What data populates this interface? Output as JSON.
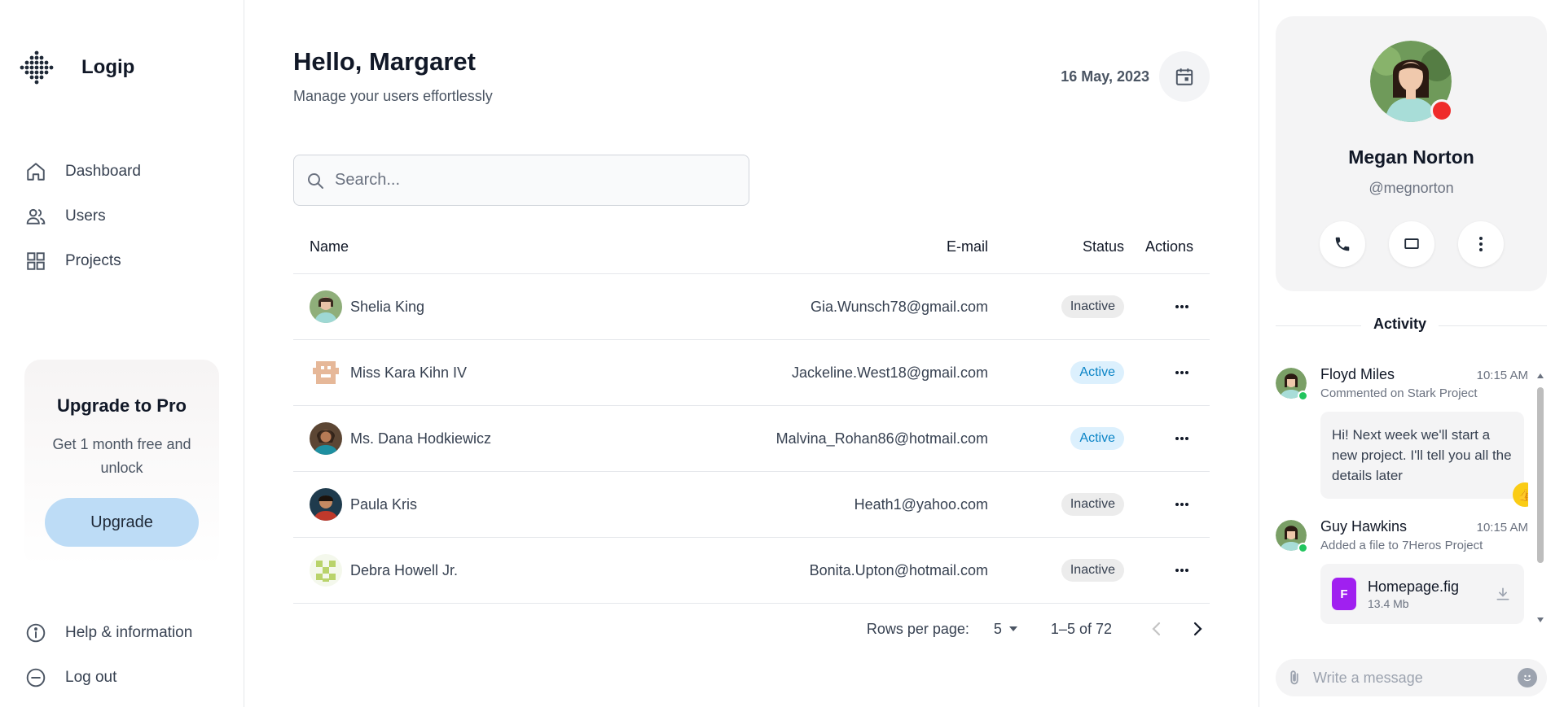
{
  "app": {
    "name": "Logip"
  },
  "nav": {
    "items": [
      {
        "label": "Dashboard",
        "icon": "home-icon"
      },
      {
        "label": "Users",
        "icon": "users-icon"
      },
      {
        "label": "Projects",
        "icon": "grid-icon"
      }
    ],
    "bottom": [
      {
        "label": "Help & information",
        "icon": "info-icon"
      },
      {
        "label": "Log out",
        "icon": "logout-icon"
      }
    ]
  },
  "promo": {
    "title": "Upgrade to Pro",
    "text": "Get 1 month free and unlock",
    "button": "Upgrade"
  },
  "header": {
    "greeting": "Hello, Margaret",
    "subtitle": "Manage your users effortlessly",
    "date": "16 May, 2023"
  },
  "search": {
    "placeholder": "Search..."
  },
  "table": {
    "columns": {
      "name": "Name",
      "email": "E-mail",
      "status": "Status",
      "actions": "Actions"
    },
    "rows": [
      {
        "name": "Shelia King",
        "email": "Gia.Wunsch78@gmail.com",
        "status": "Inactive"
      },
      {
        "name": "Miss Kara Kihn IV",
        "email": "Jackeline.West18@gmail.com",
        "status": "Active"
      },
      {
        "name": "Ms. Dana Hodkiewicz",
        "email": "Malvina_Rohan86@hotmail.com",
        "status": "Active"
      },
      {
        "name": "Paula Kris",
        "email": "Heath1@yahoo.com",
        "status": "Inactive"
      },
      {
        "name": "Debra Howell Jr.",
        "email": "Bonita.Upton@hotmail.com",
        "status": "Inactive"
      }
    ]
  },
  "pagination": {
    "rows_per_page_label": "Rows per page:",
    "rows_per_page": "5",
    "range": "1–5 of 72"
  },
  "profile": {
    "name": "Megan Norton",
    "handle": "@megnorton",
    "status_color": "#ef2b2b"
  },
  "activity": {
    "title": "Activity",
    "items": [
      {
        "name": "Floyd Miles",
        "time": "10:15 AM",
        "desc": "Commented on Stark Project",
        "message": "Hi! Next week we'll start a new project. I'll tell you all the details later",
        "reaction": "👍"
      },
      {
        "name": "Guy Hawkins",
        "time": "10:15 AM",
        "desc": "Added a file to 7Heros Project",
        "file": {
          "icon_letter": "F",
          "name": "Homepage.fig",
          "size": "13.4 Mb"
        }
      }
    ]
  },
  "message_box": {
    "placeholder": "Write a message"
  },
  "colors": {
    "accent": "#bddcf6",
    "active_badge_bg": "#dcf0fd",
    "active_badge_text": "#0a84c6",
    "inactive_badge_bg": "#ececec",
    "file_icon": "#a020f0",
    "online": "#22c55e"
  }
}
